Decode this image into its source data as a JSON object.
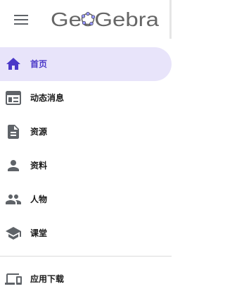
{
  "header": {
    "menu_icon": "hamburger-menu-icon",
    "logo_text": "GeoGebra"
  },
  "colors": {
    "accent": "#4b39c8",
    "active_bg": "#e8e4fa",
    "icon_gray": "#5f6368",
    "logo_gray": "#666666"
  },
  "nav": {
    "items": [
      {
        "label": "首页",
        "icon": "home-icon",
        "active": true
      },
      {
        "label": "动态消息",
        "icon": "news-feed-icon",
        "active": false
      },
      {
        "label": "资源",
        "icon": "document-icon",
        "active": false
      },
      {
        "label": "资料",
        "icon": "person-icon",
        "active": false
      },
      {
        "label": "人物",
        "icon": "people-icon",
        "active": false
      },
      {
        "label": "课堂",
        "icon": "school-icon",
        "active": false
      }
    ]
  },
  "footer": {
    "download_label": "应用下载",
    "download_icon": "devices-icon"
  }
}
